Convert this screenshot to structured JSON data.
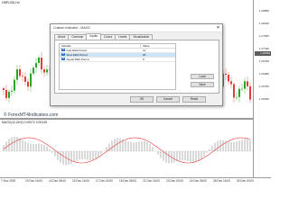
{
  "chart": {
    "symbol_label": "GBPUSD,H4",
    "indicator_label": "MACD(12,26,9) 0.00072 0.00135",
    "watermark": "© ForexMT4Indicators.com",
    "price_ticks": [
      "1.28850",
      "1.28340",
      "1.27825",
      "1.27310",
      "1.26795",
      "1.26280",
      "1.25765",
      "1.25250"
    ],
    "current_price": "1.26650",
    "time_ticks": [
      "7 Nov 2020",
      "10 Dec 16:00",
      "14 Dec 08:00",
      "15 Dec 16:00",
      "17 Dec 00:00",
      "18 Dec 08:00",
      "21 Dec 16:00",
      "23 Dec 00:00",
      "24 Dec 08:00",
      "28 Dec 16:00",
      "30 Dec 00:00"
    ],
    "colors": {
      "bull": "#2aa52a",
      "bear": "#e23b3b",
      "signal": "#e23b3b"
    }
  },
  "dialog": {
    "title": "Custom Indicator - MACD",
    "close_icon": "close-icon",
    "tabs": [
      "About",
      "Common",
      "Inputs",
      "Colors",
      "Levels",
      "Visualization"
    ],
    "active_tab": "Inputs",
    "columns": {
      "variable": "Variable",
      "value": "Value"
    },
    "rows": [
      {
        "icon": "ab",
        "variable": "Fast EMA Period",
        "value": "12"
      },
      {
        "icon": "ab",
        "variable": "Slow EMA Period",
        "value": "26"
      },
      {
        "icon": "ab",
        "variable": "Signal SMA Period",
        "value": "9"
      }
    ],
    "buttons": {
      "load": "Load",
      "save": "Save",
      "ok": "OK",
      "cancel": "Cancel",
      "reset": "Reset"
    }
  }
}
